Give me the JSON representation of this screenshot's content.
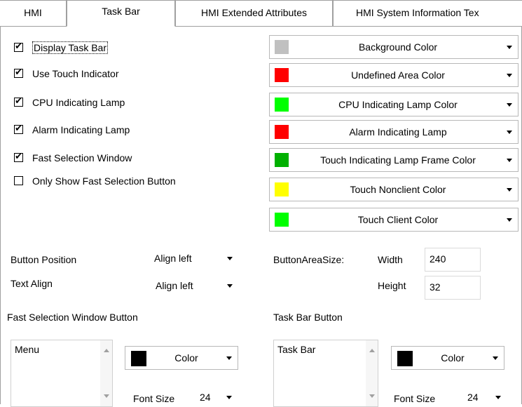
{
  "tabs": [
    {
      "label": "HMI"
    },
    {
      "label": "Task Bar"
    },
    {
      "label": "HMI Extended Attributes"
    },
    {
      "label": "HMI System Information Tex"
    }
  ],
  "checkboxes": [
    {
      "label": "Display Task Bar",
      "checked": true
    },
    {
      "label": "Use Touch Indicator",
      "checked": true
    },
    {
      "label": "CPU Indicating Lamp",
      "checked": true
    },
    {
      "label": "Alarm Indicating Lamp",
      "checked": true
    },
    {
      "label": "Fast Selection Window",
      "checked": true
    },
    {
      "label": "Only Show Fast Selection Button",
      "checked": false
    }
  ],
  "color_dropdowns": [
    {
      "label": "Background Color",
      "color": "#c0c0c0"
    },
    {
      "label": "Undefined Area Color",
      "color": "#ff0000"
    },
    {
      "label": "CPU Indicating Lamp Color",
      "color": "#00ff00"
    },
    {
      "label": "Alarm Indicating Lamp",
      "color": "#ff0000"
    },
    {
      "label": "Touch Indicating Lamp Frame Color",
      "color": "#00b000"
    },
    {
      "label": "Touch Nonclient Color",
      "color": "#ffff00"
    },
    {
      "label": "Touch Client Color",
      "color": "#00ff00"
    }
  ],
  "layout_settings": {
    "button_position_label": "Button Position",
    "button_position_value": "Align left",
    "text_align_label": "Text Align",
    "text_align_value": "Align left",
    "button_area_size_label": "ButtonAreaSize:",
    "width_label": "Width",
    "width_value": "240",
    "height_label": "Height",
    "height_value": "32"
  },
  "fast_selection": {
    "title": "Fast Selection Window Button",
    "list_item": "Menu",
    "color_label": "Color",
    "color": "#000000",
    "font_size_label": "Font Size",
    "font_size_value": "24"
  },
  "task_bar_button": {
    "title": "Task Bar Button",
    "list_item": "Task Bar",
    "color_label": "Color",
    "color": "#000000",
    "font_size_label": "Font Size",
    "font_size_value": "24"
  }
}
